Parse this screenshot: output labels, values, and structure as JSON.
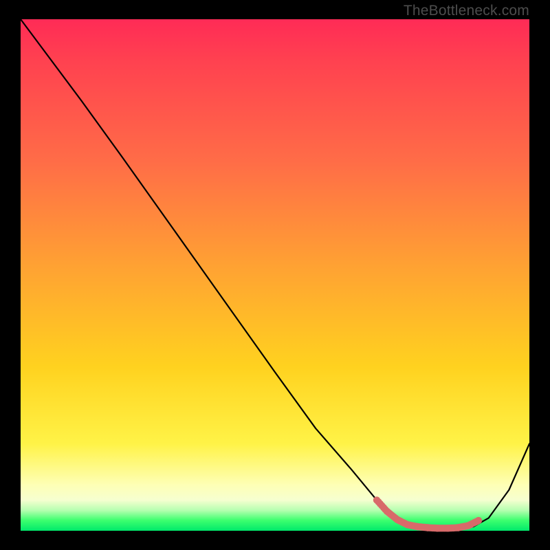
{
  "watermark": "TheBottleneck.com",
  "chart_data": {
    "type": "line",
    "title": "",
    "xlabel": "",
    "ylabel": "",
    "xlim": [
      0,
      100
    ],
    "ylim": [
      0,
      100
    ],
    "grid": false,
    "legend": false,
    "series": [
      {
        "name": "bottleneck-curve",
        "style": "line-black",
        "x": [
          0,
          6,
          12,
          20,
          30,
          40,
          50,
          58,
          65,
          70,
          73,
          76,
          80,
          83,
          86,
          89,
          92,
          96,
          100
        ],
        "y": [
          100,
          92,
          84,
          73,
          59,
          45,
          31,
          20,
          12,
          6,
          3,
          1.2,
          0.6,
          0.5,
          0.5,
          0.8,
          2.5,
          8,
          17
        ]
      },
      {
        "name": "sweet-spot-band",
        "style": "dots-salmon",
        "x": [
          70,
          72,
          74,
          76,
          78,
          80,
          82,
          84,
          86,
          88,
          90
        ],
        "y": [
          6,
          3.8,
          2.2,
          1.2,
          0.8,
          0.6,
          0.5,
          0.5,
          0.6,
          1.0,
          2.0
        ]
      }
    ],
    "background_gradient": {
      "top": "#ff2b56",
      "mid1": "#ff6d47",
      "mid2": "#ffd21f",
      "mid3": "#feffb5",
      "bottom": "#00e96b"
    }
  }
}
